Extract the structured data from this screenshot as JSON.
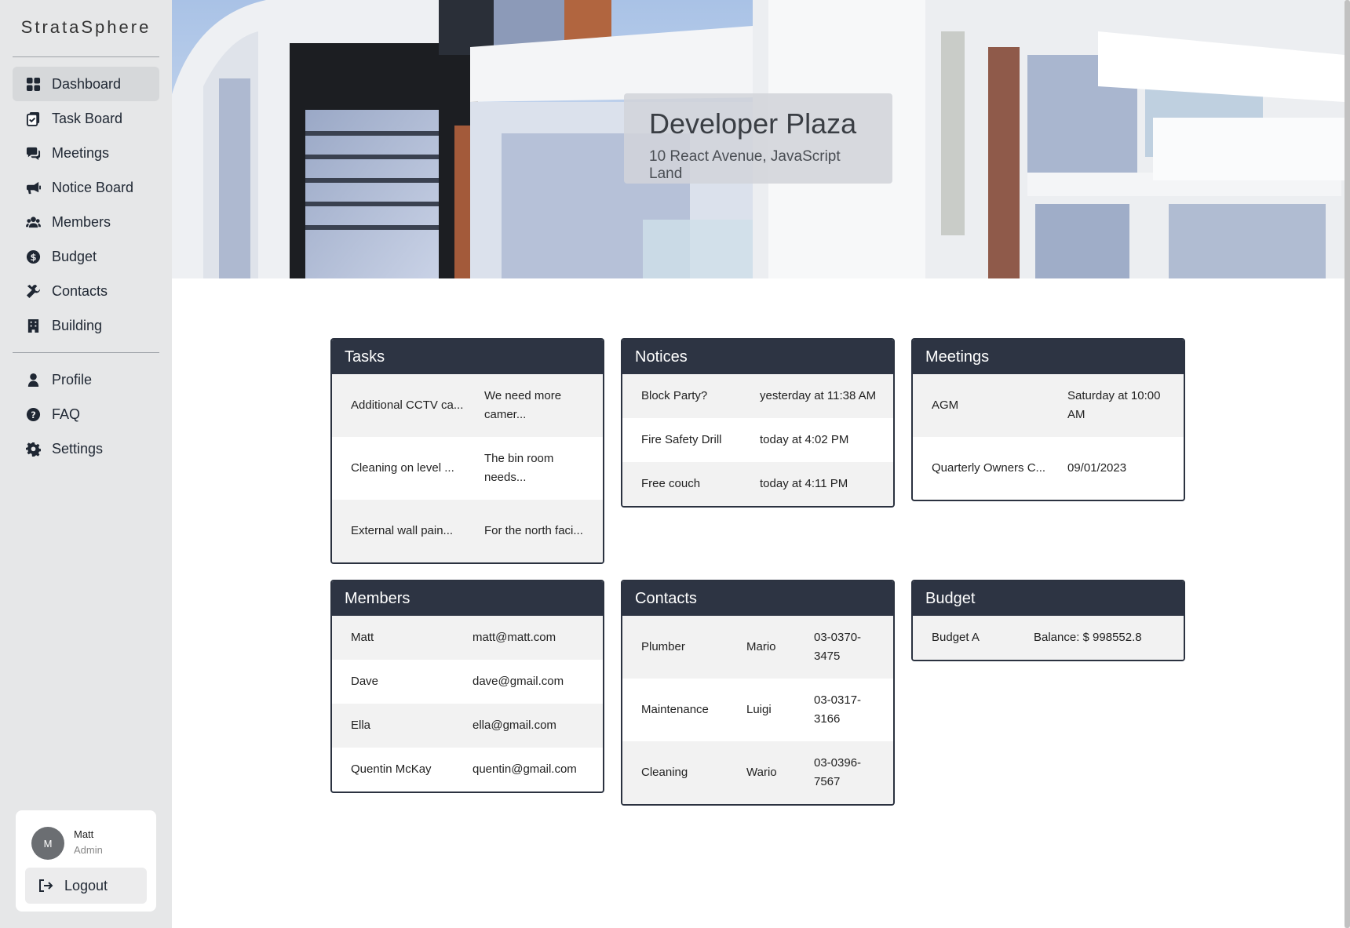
{
  "app": {
    "brand": "StrataSphere"
  },
  "sidebar": {
    "nav": [
      {
        "label": "Dashboard",
        "icon": "dashboard-icon",
        "active": true
      },
      {
        "label": "Task Board",
        "icon": "tasks-icon",
        "active": false
      },
      {
        "label": "Meetings",
        "icon": "meetings-icon",
        "active": false
      },
      {
        "label": "Notice Board",
        "icon": "megaphone-icon",
        "active": false
      },
      {
        "label": "Members",
        "icon": "users-icon",
        "active": false
      },
      {
        "label": "Budget",
        "icon": "dollar-icon",
        "active": false
      },
      {
        "label": "Contacts",
        "icon": "tools-icon",
        "active": false
      },
      {
        "label": "Building",
        "icon": "building-icon",
        "active": false
      }
    ],
    "secondary": [
      {
        "label": "Profile",
        "icon": "user-icon"
      },
      {
        "label": "FAQ",
        "icon": "question-icon"
      },
      {
        "label": "Settings",
        "icon": "gear-icon"
      }
    ],
    "user": {
      "initial": "M",
      "name": "Matt",
      "role": "Admin",
      "logout_label": "Logout"
    }
  },
  "hero": {
    "title": "Developer Plaza",
    "address": "10 React Avenue, JavaScript Land"
  },
  "panels": {
    "tasks": {
      "title": "Tasks",
      "rows": [
        [
          "Additional CCTV ca...",
          "We need more camer..."
        ],
        [
          "Cleaning on level ...",
          "The bin room needs..."
        ],
        [
          "External wall pain...",
          "For the north faci..."
        ]
      ]
    },
    "notices": {
      "title": "Notices",
      "rows": [
        [
          "Block Party?",
          "yesterday at 11:38 AM"
        ],
        [
          "Fire Safety Drill",
          "today at 4:02 PM"
        ],
        [
          "Free couch",
          "today at 4:11 PM"
        ]
      ]
    },
    "meetings": {
      "title": "Meetings",
      "rows": [
        [
          "AGM",
          "Saturday at 10:00 AM"
        ],
        [
          "Quarterly Owners C...",
          "09/01/2023"
        ]
      ]
    },
    "members": {
      "title": "Members",
      "rows": [
        [
          "Matt",
          "matt@matt.com"
        ],
        [
          "Dave",
          "dave@gmail.com"
        ],
        [
          "Ella",
          "ella@gmail.com"
        ],
        [
          "Quentin McKay",
          "quentin@gmail.com"
        ]
      ]
    },
    "contacts": {
      "title": "Contacts",
      "rows": [
        [
          "Plumber",
          "Mario",
          "03-0370-3475"
        ],
        [
          "Maintenance",
          "Luigi",
          "03-0317-3166"
        ],
        [
          "Cleaning",
          "Wario",
          "03-0396-7567"
        ]
      ]
    },
    "budget": {
      "title": "Budget",
      "rows": [
        [
          "Budget A",
          "Balance: $ 998552.8"
        ]
      ]
    }
  }
}
